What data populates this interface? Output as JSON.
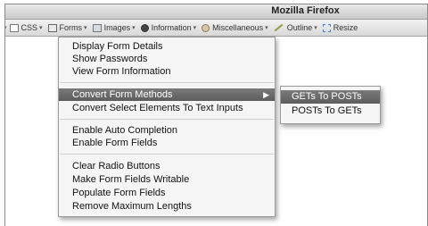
{
  "window": {
    "title": "Mozilla Firefox"
  },
  "toolbar": {
    "items": [
      {
        "label": "CSS",
        "icon": "css-icon"
      },
      {
        "label": "Forms",
        "icon": "forms-icon"
      },
      {
        "label": "Images",
        "icon": "images-icon"
      },
      {
        "label": "Information",
        "icon": "information-icon"
      },
      {
        "label": "Miscellaneous",
        "icon": "miscellaneous-icon"
      },
      {
        "label": "Outline",
        "icon": "outline-icon"
      },
      {
        "label": "Resize",
        "icon": "resize-icon"
      }
    ]
  },
  "menu": {
    "items": [
      {
        "label": "Display Form Details"
      },
      {
        "label": "Show Passwords"
      },
      {
        "label": "View Form Information"
      },
      {
        "label": "Convert Form Methods",
        "highlighted": true,
        "has_submenu": true
      },
      {
        "label": "Convert Select Elements To Text Inputs"
      },
      {
        "label": "Enable Auto Completion"
      },
      {
        "label": "Enable Form Fields"
      },
      {
        "label": "Clear Radio Buttons"
      },
      {
        "label": "Make Form Fields Writable"
      },
      {
        "label": "Populate Form Fields"
      },
      {
        "label": "Remove Maximum Lengths"
      }
    ]
  },
  "submenu": {
    "items": [
      {
        "label": "GETs To POSTs",
        "highlighted": true
      },
      {
        "label": "POSTs To GETs"
      }
    ]
  },
  "colors": {
    "highlight": "#666666",
    "menu_bg": "#f5f5f5"
  }
}
